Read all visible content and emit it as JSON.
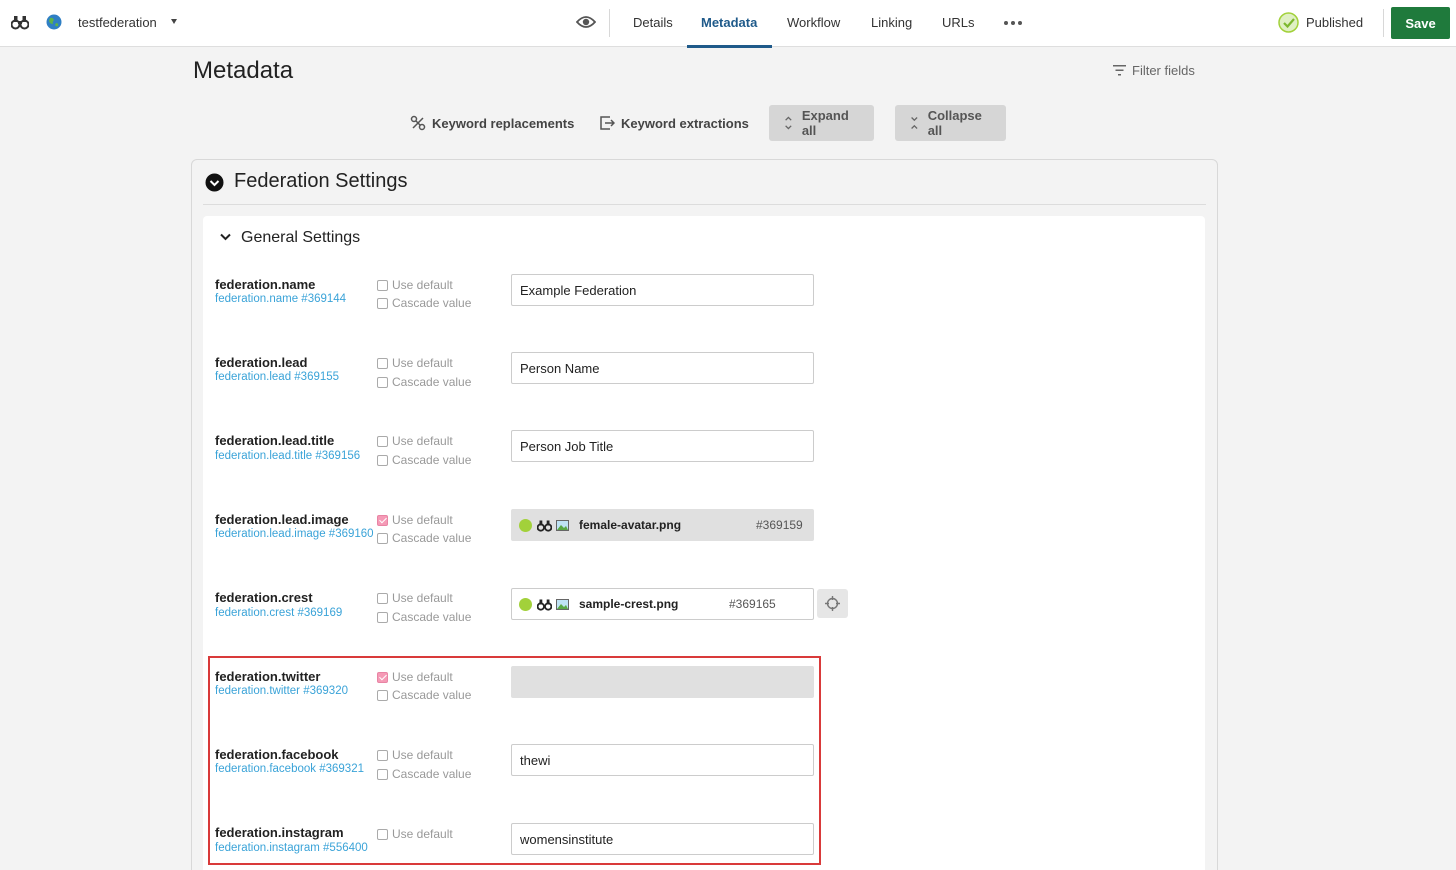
{
  "topbar": {
    "site_name": "testfederation",
    "tabs": [
      "Details",
      "Metadata",
      "Workflow",
      "Linking",
      "URLs"
    ],
    "active_tab": "Metadata",
    "status": "Published",
    "save_label": "Save"
  },
  "page": {
    "title": "Metadata",
    "filter_label": "Filter fields"
  },
  "toolbar": {
    "keyword_replacements": "Keyword replacements",
    "keyword_extractions": "Keyword extractions",
    "expand_all": "Expand all",
    "collapse_all": "Collapse all"
  },
  "section": {
    "title": "Federation Settings",
    "group_title": "General Settings"
  },
  "labels": {
    "use_default": "Use default",
    "cascade_value": "Cascade value"
  },
  "fields": [
    {
      "name": "federation.name",
      "id": "federation.name #369144",
      "use_default": false,
      "value": "Example Federation"
    },
    {
      "name": "federation.lead",
      "id": "federation.lead #369155",
      "use_default": false,
      "value": "Person Name"
    },
    {
      "name": "federation.lead.title",
      "id": "federation.lead.title #369156",
      "use_default": false,
      "value": "Person Job Title"
    },
    {
      "name": "federation.lead.image",
      "id": "federation.lead.image #369160",
      "use_default": true,
      "asset_name": "female-avatar.png",
      "asset_id": "#369159"
    },
    {
      "name": "federation.crest",
      "id": "federation.crest #369169",
      "use_default": false,
      "asset_name": "sample-crest.png",
      "asset_id": "#369165"
    },
    {
      "name": "federation.twitter",
      "id": "federation.twitter #369320",
      "use_default": true,
      "value": ""
    },
    {
      "name": "federation.facebook",
      "id": "federation.facebook #369321",
      "use_default": false,
      "value": "thewi"
    },
    {
      "name": "federation.instagram",
      "id": "federation.instagram #556400",
      "use_default": false,
      "value": "womensinstitute"
    }
  ],
  "colors": {
    "accent": "#1f5a8a",
    "save": "#1f7a3c",
    "link": "#3aa3d8",
    "highlight": "#d93a3a",
    "checked": "#f59ab6"
  }
}
